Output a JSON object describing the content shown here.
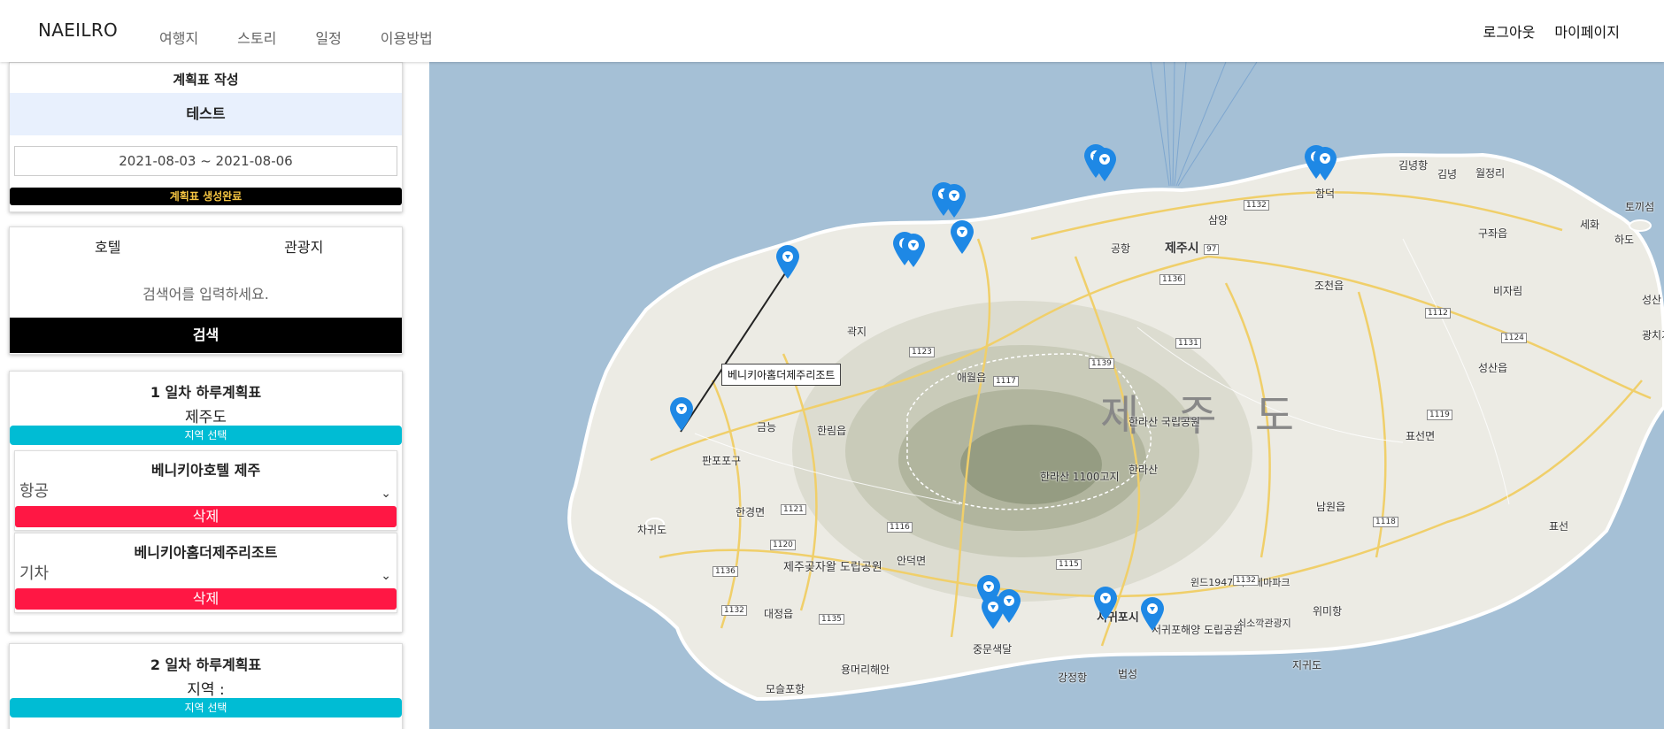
{
  "header": {
    "brand": "NAEILRO",
    "nav": [
      "여행지",
      "스토리",
      "일정",
      "이용방법"
    ],
    "logout": "로그아웃",
    "mypage": "마이페이지"
  },
  "plan": {
    "title": "계획표 작성",
    "name": "테스트",
    "dates": "2021-08-03 ~ 2021-08-06",
    "done_label": "계획표 생성완료"
  },
  "search": {
    "tabs": [
      "호텔",
      "관광지"
    ],
    "hint": "검색어를 입력하세요.",
    "button": "검색"
  },
  "days": [
    {
      "title": "1 일차 하루계획표",
      "region": "제주도",
      "region_button": "지역 선택",
      "items": [
        {
          "name": "베니키아호텔 제주",
          "transport": "항공",
          "delete": "삭제"
        },
        {
          "name": "베니키아홈더제주리조트",
          "transport": "기차",
          "delete": "삭제"
        }
      ]
    },
    {
      "title": "2 일차 하루계획표",
      "region": "지역 :",
      "region_button": "지역 선택"
    }
  ],
  "map": {
    "tooltip": "베니키아홈더제주리조트",
    "big_label": "제 주 도",
    "labels": [
      "제주시",
      "한라산 국립공원",
      "한라산",
      "한라산 1100고지",
      "애월읍",
      "한림읍",
      "판포포구",
      "한경면",
      "차귀도",
      "제주곶자왈 도립공원",
      "대정읍",
      "안덕면",
      "중문색달",
      "서귀포시",
      "서귀포해양 도립공원",
      "윈드1947 카트테마파크",
      "쇠소깍관광지",
      "위미항",
      "남원읍",
      "표선면",
      "성산읍",
      "조천읍",
      "구좌읍",
      "비자림",
      "세화",
      "하도",
      "토끼섬",
      "김녕항",
      "김녕",
      "월정리",
      "함덕",
      "삼양",
      "공항",
      "곽지",
      "금능",
      "모슬포항",
      "용머리해안",
      "강정항",
      "법성",
      "지귀도",
      "표선",
      "성산",
      "광치기"
    ],
    "route_numbers": [
      "1132",
      "1136",
      "97",
      "1123",
      "1117",
      "1139",
      "1131",
      "1112",
      "1124",
      "1119",
      "1118",
      "1116",
      "1115",
      "1120",
      "1121",
      "1135",
      "1132",
      "1136",
      "1132"
    ],
    "colors": {
      "sea": "#a5c0d6",
      "land": "#ecebe4",
      "pin": "#1e88e5"
    }
  }
}
